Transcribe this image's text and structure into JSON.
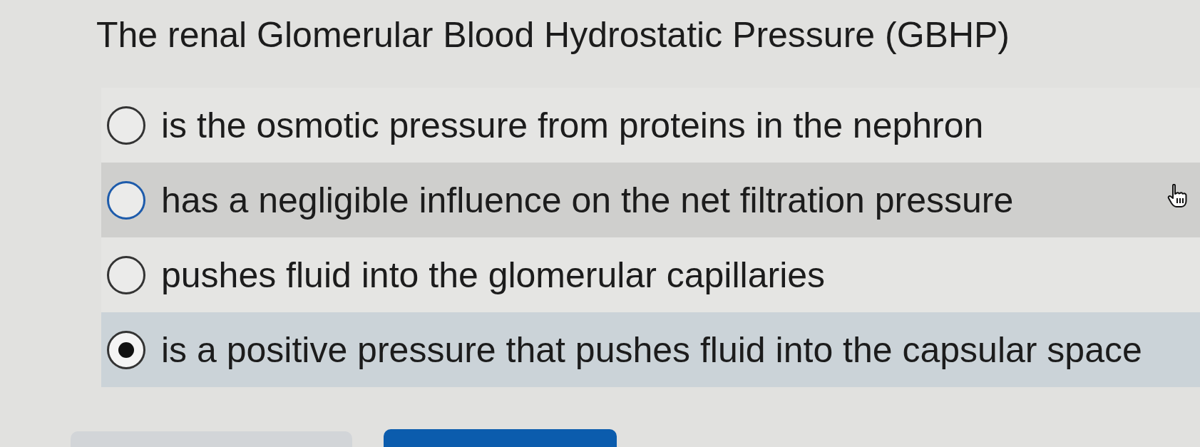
{
  "question": {
    "text": "The renal Glomerular Blood Hydrostatic Pressure (GBHP)"
  },
  "options": [
    {
      "label": "is the osmotic pressure from proteins in the nephron",
      "selected": false,
      "hovered": false
    },
    {
      "label": "has a negligible influence on the net filtration pressure",
      "selected": false,
      "hovered": true
    },
    {
      "label": "pushes fluid into the glomerular capillaries",
      "selected": false,
      "hovered": false
    },
    {
      "label": "is a positive pressure that pushes fluid into the capsular space",
      "selected": true,
      "hovered": false
    }
  ],
  "buttons": [
    {
      "kind": "secondary"
    },
    {
      "kind": "primary"
    }
  ]
}
